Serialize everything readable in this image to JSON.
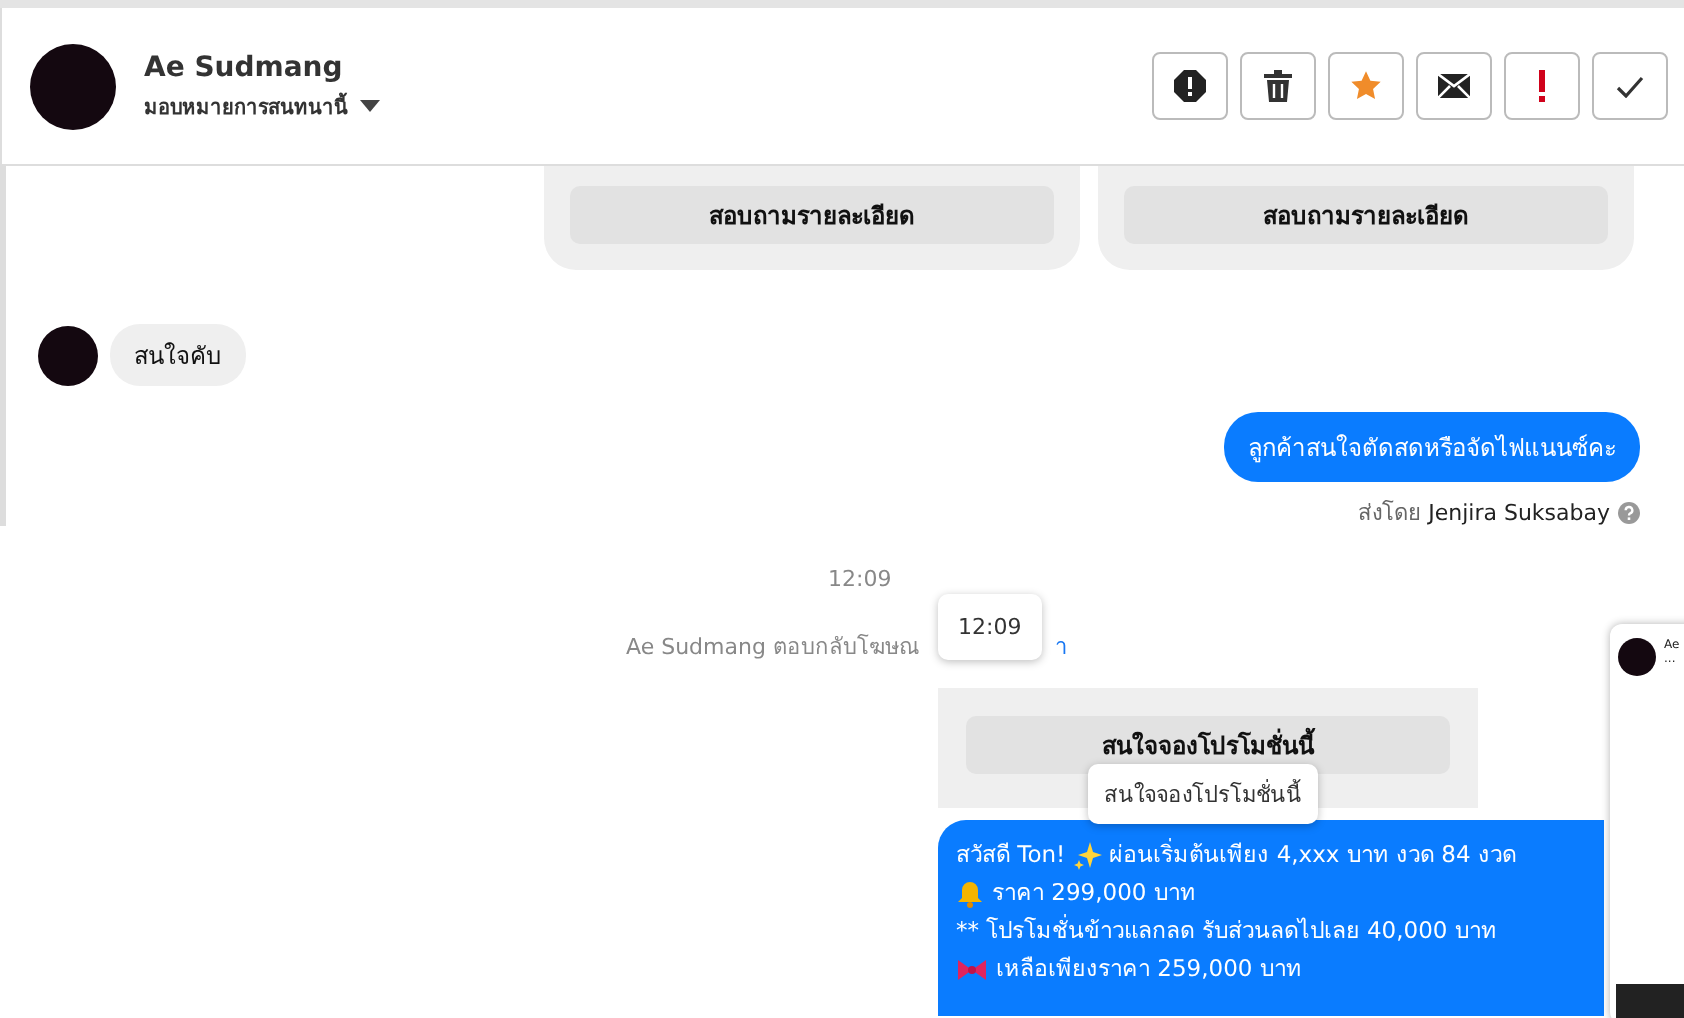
{
  "header": {
    "name": "Ae Sudmang",
    "subtitle": "มอบหมายการสนทนานี้",
    "actions": [
      {
        "kind": "alert"
      },
      {
        "kind": "trash"
      },
      {
        "kind": "star"
      },
      {
        "kind": "mail"
      },
      {
        "kind": "exclaim"
      },
      {
        "kind": "check"
      }
    ]
  },
  "messages": [
    {
      "kind": "cards",
      "buttons": [
        "สอบถามรายละเอียด",
        "สอบถามรายละเอียด"
      ]
    },
    {
      "kind": "incoming",
      "text": "สนใจคับ"
    },
    {
      "kind": "outgoing",
      "text": "ลูกค้าสนใจตัดสดหรือจัดไฟแนนซ์คะ",
      "sender_prefix": "ส่งโดย",
      "sender": "Jenjira Suksabay"
    },
    {
      "kind": "time",
      "text": "12:09"
    },
    {
      "kind": "notice",
      "text": "Ae Sudmang ตอบกลับโฆษณ",
      "link": "า"
    },
    {
      "kind": "card",
      "button": "สนใจจองโปรโมชั่นนี้"
    },
    {
      "kind": "promo",
      "lines": [
        {
          "kind": "sparkle",
          "text": "สวัสดี Ton!",
          "rest": "ผ่อนเริ่มต้นเพียง 4,xxx บาท งวด 84 งวด"
        },
        {
          "kind": "bell",
          "text": "ราคา 299,000 บาท"
        },
        {
          "kind": "plain",
          "text": "** โปรโมชั่นข้าวแลกลด รับส่วนลดไปเลย 40,000 บาท"
        },
        {
          "kind": "ribbon",
          "text": "เหลือเพียงราคา 259,000 บาท"
        }
      ]
    }
  ],
  "tooltips": [
    {
      "text": "12:09"
    },
    {
      "text": "สนใจจองโปรโมชั่นนี้"
    }
  ],
  "side_card": {
    "name": "Ae",
    "preview": "..."
  }
}
